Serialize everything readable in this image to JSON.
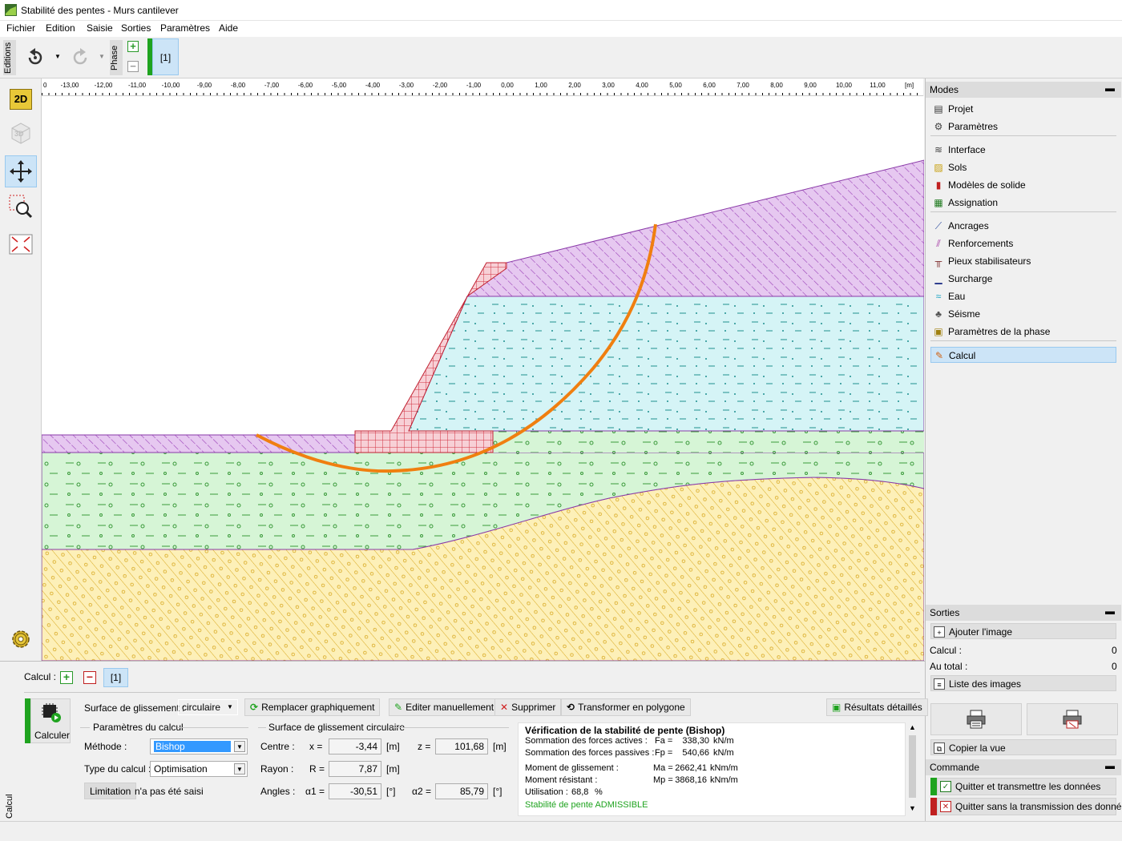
{
  "window": {
    "title": "Stabilité des pentes - Murs cantilever"
  },
  "menu": [
    "Fichier",
    "Edition",
    "Saisie",
    "Sorties",
    "Paramètres",
    "Aide"
  ],
  "toolbar": {
    "editions_label": "Editions",
    "phase_label": "Phase",
    "phase_tab": "[1]"
  },
  "left_tools": {
    "mode_2d": "2D",
    "mode_3d": "3D"
  },
  "ruler": {
    "unit": "[m]",
    "ticks": [
      "-13,00",
      "-12,00",
      "-11,00",
      "-10,00",
      "-9,00",
      "-8,00",
      "-7,00",
      "-6,00",
      "-5,00",
      "-4,00",
      "-3,00",
      "-2,00",
      "-1,00",
      "0,00",
      "1,00",
      "2,00",
      "3,00",
      "4,00",
      "5,00",
      "6,00",
      "7,00",
      "8,00",
      "9,00",
      "10,00",
      "11,00"
    ]
  },
  "modes": {
    "title": "Modes",
    "items": [
      {
        "label": "Projet",
        "icon": "document-icon"
      },
      {
        "label": "Paramètres",
        "icon": "gear-icon"
      },
      {
        "label": "Interface",
        "icon": "interface-icon"
      },
      {
        "label": "Sols",
        "icon": "soil-icon"
      },
      {
        "label": "Modèles de solide",
        "icon": "solid-icon"
      },
      {
        "label": "Assignation",
        "icon": "assign-icon"
      },
      {
        "label": "Ancrages",
        "icon": "anchor-icon"
      },
      {
        "label": "Renforcements",
        "icon": "reinforcement-icon"
      },
      {
        "label": "Pieux stabilisateurs",
        "icon": "pile-icon"
      },
      {
        "label": "Surcharge",
        "icon": "surcharge-icon"
      },
      {
        "label": "Eau",
        "icon": "water-icon"
      },
      {
        "label": "Séisme",
        "icon": "earthquake-icon"
      },
      {
        "label": "Paramètres de la phase",
        "icon": "phase-params-icon"
      },
      {
        "label": "Calcul",
        "icon": "calc-icon"
      }
    ]
  },
  "sorties": {
    "title": "Sorties",
    "add_image": "Ajouter l'image",
    "calcul_label": "Calcul :",
    "calcul_value": "0",
    "total_label": "Au total :",
    "total_value": "0",
    "image_list": "Liste des images",
    "copy_view": "Copier la vue"
  },
  "commande": {
    "title": "Commande",
    "quit_transmit": "Quitter et transmettre les données",
    "quit_no_transmit": "Quitter sans la transmission des données"
  },
  "bottom": {
    "side_label": "Calcul",
    "calcul_label": "Calcul :",
    "phase_tab": "[1]",
    "calc_button": "Calculer",
    "surface_label": "Surface de glissement :",
    "surface_value": "circulaire",
    "btn_replace": "Remplacer graphiquement",
    "btn_edit": "Editer manuellement",
    "btn_delete": "Supprimer",
    "btn_transform": "Transformer en polygone",
    "btn_results": "Résultats détaillés",
    "params_group": "Paramètres du calcul",
    "method_label": "Méthode :",
    "method_value": "Bishop",
    "type_label": "Type du calcul :",
    "type_value": "Optimisation",
    "limitation_btn": "Limitation",
    "limitation_text": "n'a pas été saisi",
    "circle_group": "Surface de glissement circulaire",
    "centre_label": "Centre :",
    "x_label": "x =",
    "x_value": "-3,44",
    "z_label": "z =",
    "z_value": "101,68",
    "unit_m": "[m]",
    "rayon_label": "Rayon :",
    "r_label": "R =",
    "r_value": "7,87",
    "angles_label": "Angles :",
    "a1_label": "α1 =",
    "a1_value": "-30,51",
    "a2_label": "α2 =",
    "a2_value": "85,79",
    "unit_deg": "[°]"
  },
  "results": {
    "title": "Vérification de la stabilité de pente (Bishop)",
    "active_label": "Sommation des forces actives :",
    "active_sym": "Fa =",
    "active_val": "338,30",
    "active_unit": "kN/m",
    "passive_label": "Sommation des forces passives :",
    "passive_sym": "Fp =",
    "passive_val": "540,66",
    "passive_unit": "kN/m",
    "msl_label": "Moment de glissement :",
    "msl_sym": "Ma =",
    "msl_val": "2662,41",
    "msl_unit": "kNm/m",
    "mres_label": "Moment résistant :",
    "mres_sym": "Mp =",
    "mres_val": "3868,16",
    "mres_unit": "kNm/m",
    "util_label": "Utilisation :",
    "util_val": "68,8",
    "util_unit": "%",
    "verdict": "Stabilité de pente ADMISSIBLE"
  },
  "colors": {
    "purple": "#e6c8f0",
    "cyan": "#d5f4f6",
    "green": "#d6f5d6",
    "yellow": "#fdf0b8",
    "wall": "#f7d0d6",
    "slip": "#f07f10"
  }
}
